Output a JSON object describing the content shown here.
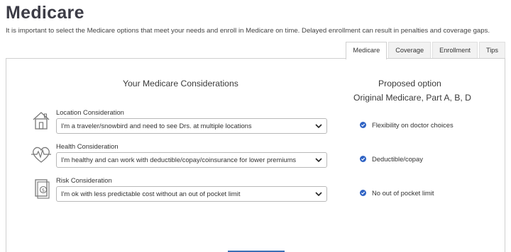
{
  "page": {
    "title": "Medicare",
    "intro": "It is important to select the Medicare options that meet your needs and enroll in Medicare on time. Delayed enrollment can result in penalties and coverage gaps."
  },
  "tabs": [
    {
      "label": "Medicare",
      "active": true
    },
    {
      "label": "Coverage",
      "active": false
    },
    {
      "label": "Enrollment",
      "active": false
    },
    {
      "label": "Tips",
      "active": false
    }
  ],
  "panel": {
    "considerations_heading": "Your Medicare Considerations",
    "proposed_heading": "Proposed option",
    "proposed_option": "Original Medicare, Part A, B, D"
  },
  "considerations": [
    {
      "label": "Location Consideration",
      "selected": "I'm a traveler/snowbird and need to see Drs. at multiple locations",
      "benefit": "Flexibility on doctor choices",
      "icon": "house-icon"
    },
    {
      "label": "Health Consideration",
      "selected": "I'm healthy and can work with deductible/copay/coinsurance for lower premiums",
      "benefit": "Deductible/copay",
      "icon": "heart-pulse-icon"
    },
    {
      "label": "Risk Consideration",
      "selected": "I'm ok with less predictable cost without an out of pocket limit",
      "benefit": "No out of pocket limit",
      "icon": "document-dollar-icon"
    }
  ],
  "colors": {
    "accent": "#3b6fb6",
    "check": "#2f63c4",
    "icon_stroke": "#777777"
  }
}
